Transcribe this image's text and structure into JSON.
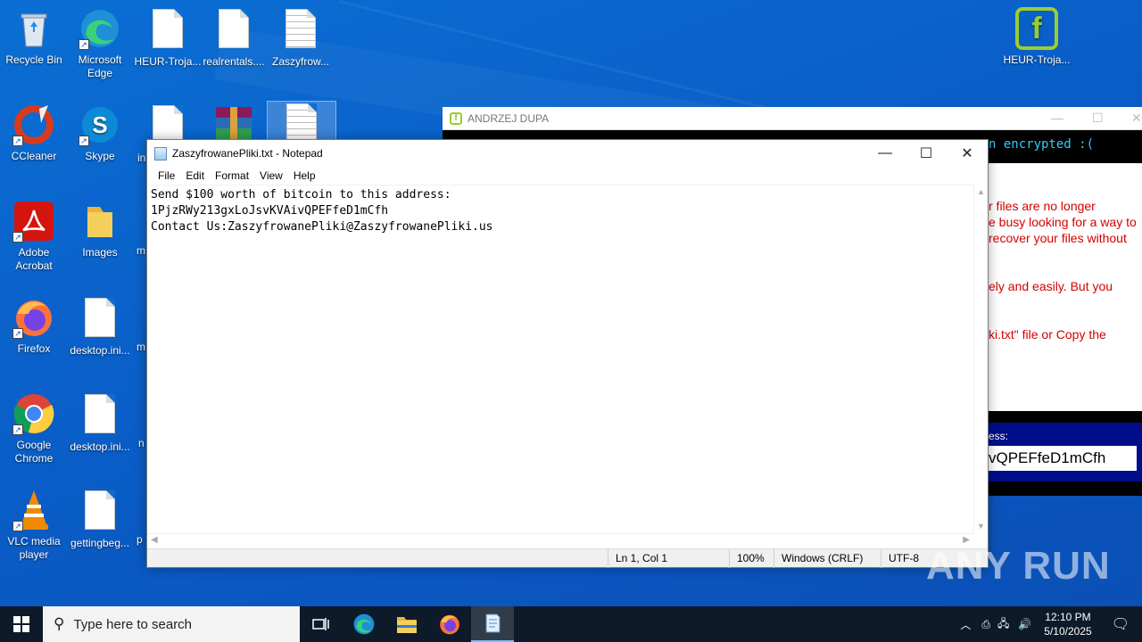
{
  "desktop": {
    "icons": [
      {
        "label": "Recycle Bin"
      },
      {
        "label": "Microsoft Edge"
      },
      {
        "label": "HEUR-Troja..."
      },
      {
        "label": "realrentals...."
      },
      {
        "label": "Zaszyfrow..."
      },
      {
        "label": "CCleaner"
      },
      {
        "label": "Skype"
      },
      {
        "label": "Adobe Acrobat"
      },
      {
        "label": "Images"
      },
      {
        "label": "Firefox"
      },
      {
        "label": "desktop.ini..."
      },
      {
        "label": "Google Chrome"
      },
      {
        "label": "desktop.ini..."
      },
      {
        "label": "VLC media player"
      },
      {
        "label": "gettingbeg..."
      },
      {
        "label": "HEUR-Troja..."
      }
    ],
    "partial_labels": [
      "in",
      "m",
      "m",
      "n",
      "p"
    ]
  },
  "ransom_window": {
    "title": "ANDRZEJ DUPA",
    "banner": "n encrypted :(",
    "lines": [
      "r files are no longer",
      "e busy looking for a way to",
      "recover your files without",
      "ely and easily. But you",
      "ki.txt\" file or Copy the"
    ],
    "address_label": "ess:",
    "address_value": "vQPEFfeD1mCfh"
  },
  "notepad": {
    "title": "ZaszyfrowanePliki.txt - Notepad",
    "menu": [
      "File",
      "Edit",
      "Format",
      "View",
      "Help"
    ],
    "lines": [
      "Send $100 worth of bitcoin to this address:",
      "1PjzRWy213gxLoJsvKVAivQPEFfeD1mCfh",
      "Contact Us:ZaszyfrowanePliki@ZaszyfrowanePliki.us"
    ],
    "status": {
      "position": "Ln 1, Col 1",
      "zoom": "100%",
      "line_ending": "Windows (CRLF)",
      "encoding": "UTF-8"
    }
  },
  "watermark": "ANY RUN",
  "taskbar": {
    "search_placeholder": "Type here to search",
    "time": "12:10 PM",
    "date": "5/10/2025"
  }
}
